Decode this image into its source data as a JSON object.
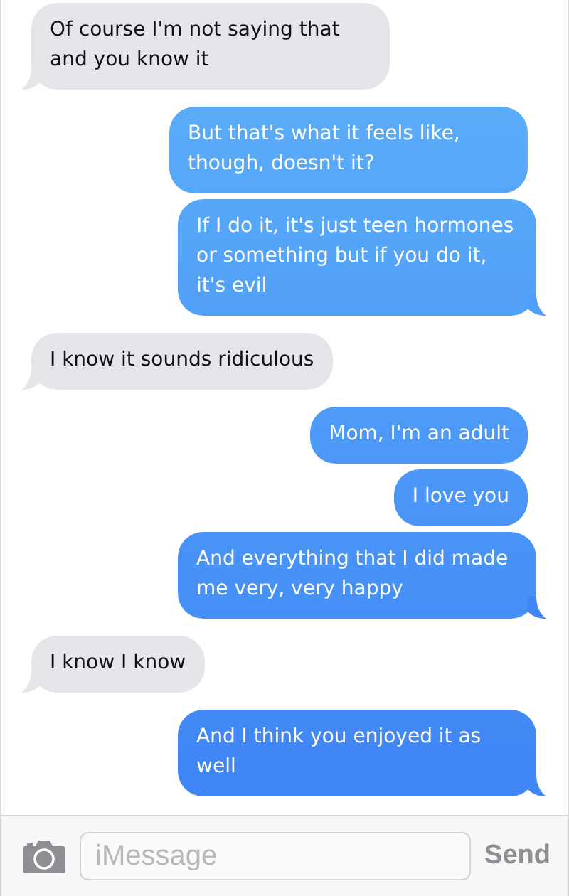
{
  "messages": [
    {
      "kind": "received",
      "text": "Of course I'm not saying that and you know it",
      "tail": true
    },
    {
      "kind": "sent",
      "text": "But that's what it feels like, though, doesn't it?",
      "tail": false
    },
    {
      "kind": "sent",
      "text": "If I do it, it's just teen hormones or something but if you do it, it's evil",
      "tail": true
    },
    {
      "kind": "received",
      "text": "I know it sounds ridiculous",
      "tail": true
    },
    {
      "kind": "sent",
      "text": "Mom, I'm an adult",
      "tail": false
    },
    {
      "kind": "sent",
      "text": "I love you",
      "tail": false
    },
    {
      "kind": "sent",
      "text": "And everything that I did made me very, very happy",
      "tail": true
    },
    {
      "kind": "received",
      "text": "I know I know",
      "tail": true
    },
    {
      "kind": "sent",
      "text": "And I think you enjoyed it as well",
      "tail": true
    }
  ],
  "composer": {
    "placeholder": "iMessage",
    "send": "Send"
  }
}
